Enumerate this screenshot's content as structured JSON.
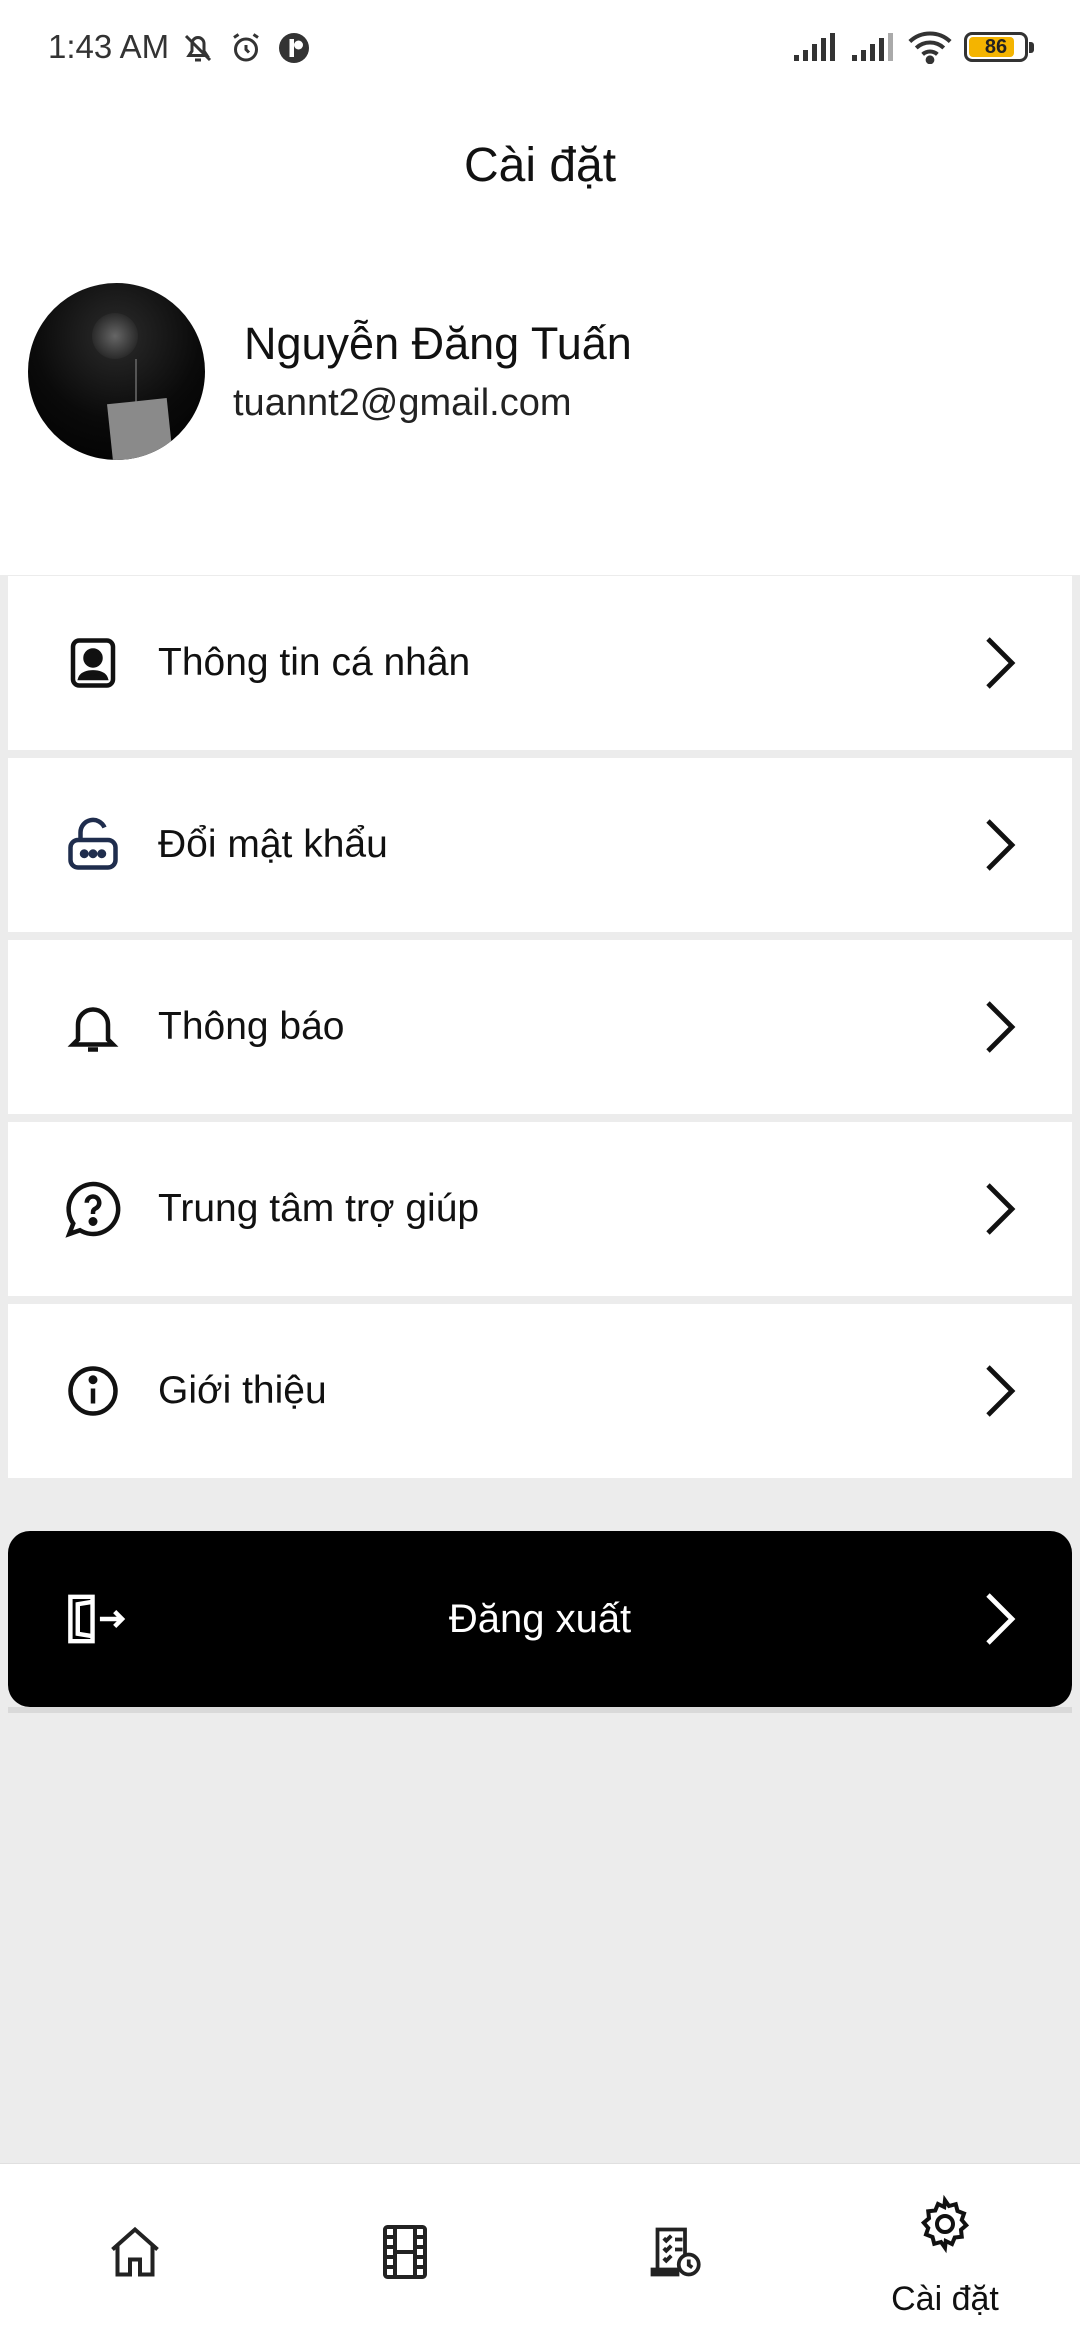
{
  "status_bar": {
    "time": "1:43 AM",
    "battery": "86",
    "icons": [
      "muted-bell-icon",
      "alarm-icon",
      "app-notification-icon",
      "signal-icon",
      "signal-icon",
      "wifi-icon",
      "battery-icon"
    ]
  },
  "header": {
    "title": "Cài đặt"
  },
  "profile": {
    "name": "Nguyễn Đăng Tuấn",
    "email": "tuannt2@gmail.com"
  },
  "menu": {
    "items": [
      {
        "label": "Thông tin cá nhân",
        "icon": "profile-card-icon"
      },
      {
        "label": "Đổi mật khẩu",
        "icon": "unlocked-padlock-icon"
      },
      {
        "label": "Thông báo",
        "icon": "bell-icon"
      },
      {
        "label": "Trung tâm trợ giúp",
        "icon": "help-chat-icon"
      },
      {
        "label": "Giới thiệu",
        "icon": "info-icon"
      }
    ]
  },
  "logout": {
    "label": "Đăng xuất",
    "icon": "logout-icon"
  },
  "bottom_nav": {
    "items": [
      {
        "icon": "home-icon",
        "label": ""
      },
      {
        "icon": "film-icon",
        "label": ""
      },
      {
        "icon": "history-list-icon",
        "label": ""
      },
      {
        "icon": "gear-icon",
        "label": "Cài đặt",
        "active": true
      }
    ]
  },
  "colors": {
    "background": "#ececec",
    "surface": "#ffffff",
    "primary_button": "#000000",
    "battery": "#f4b400"
  }
}
